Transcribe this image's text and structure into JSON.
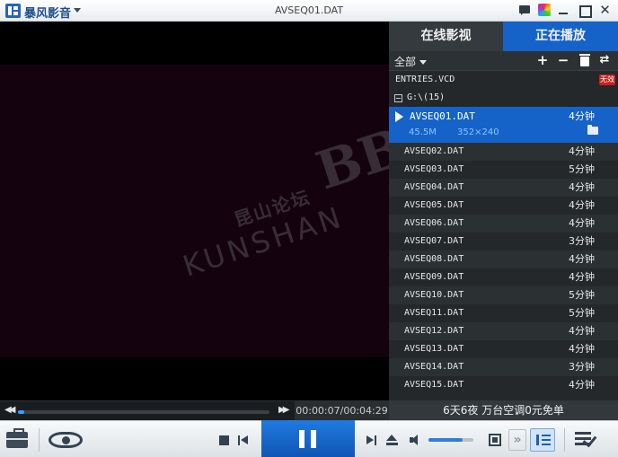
{
  "app": {
    "name": "暴风影音",
    "window_title": "AVSEQ01.DAT"
  },
  "player": {
    "elapsed_time": "00:00:07/00:04:29",
    "progress": 0.026,
    "volume": 0.75,
    "watermark": {
      "top": "昆山论坛",
      "main": "KUNSHAN",
      "big": "BBS"
    }
  },
  "panel": {
    "tabs": [
      {
        "label": "在线影视"
      },
      {
        "label": "正在播放"
      }
    ],
    "filter_label": "全部",
    "entries_file": {
      "name": "ENTRIES.VCD",
      "badge": "无效"
    },
    "folder": {
      "label": "G:\\(15)"
    },
    "current": {
      "name": "AVSEQ01.DAT",
      "duration": "4分钟",
      "size": "45.5M",
      "resolution": "352×240"
    },
    "items": [
      {
        "name": "AVSEQ02.DAT",
        "duration": "4分钟"
      },
      {
        "name": "AVSEQ03.DAT",
        "duration": "5分钟"
      },
      {
        "name": "AVSEQ04.DAT",
        "duration": "4分钟"
      },
      {
        "name": "AVSEQ05.DAT",
        "duration": "4分钟"
      },
      {
        "name": "AVSEQ06.DAT",
        "duration": "4分钟"
      },
      {
        "name": "AVSEQ07.DAT",
        "duration": "3分钟"
      },
      {
        "name": "AVSEQ08.DAT",
        "duration": "4分钟"
      },
      {
        "name": "AVSEQ09.DAT",
        "duration": "4分钟"
      },
      {
        "name": "AVSEQ10.DAT",
        "duration": "5分钟"
      },
      {
        "name": "AVSEQ11.DAT",
        "duration": "5分钟"
      },
      {
        "name": "AVSEQ12.DAT",
        "duration": "4分钟"
      },
      {
        "name": "AVSEQ13.DAT",
        "duration": "4分钟"
      },
      {
        "name": "AVSEQ14.DAT",
        "duration": "3分钟"
      },
      {
        "name": "AVSEQ15.DAT",
        "duration": "4分钟"
      }
    ],
    "ad_text": "6天6夜 万台空调0元免单"
  }
}
